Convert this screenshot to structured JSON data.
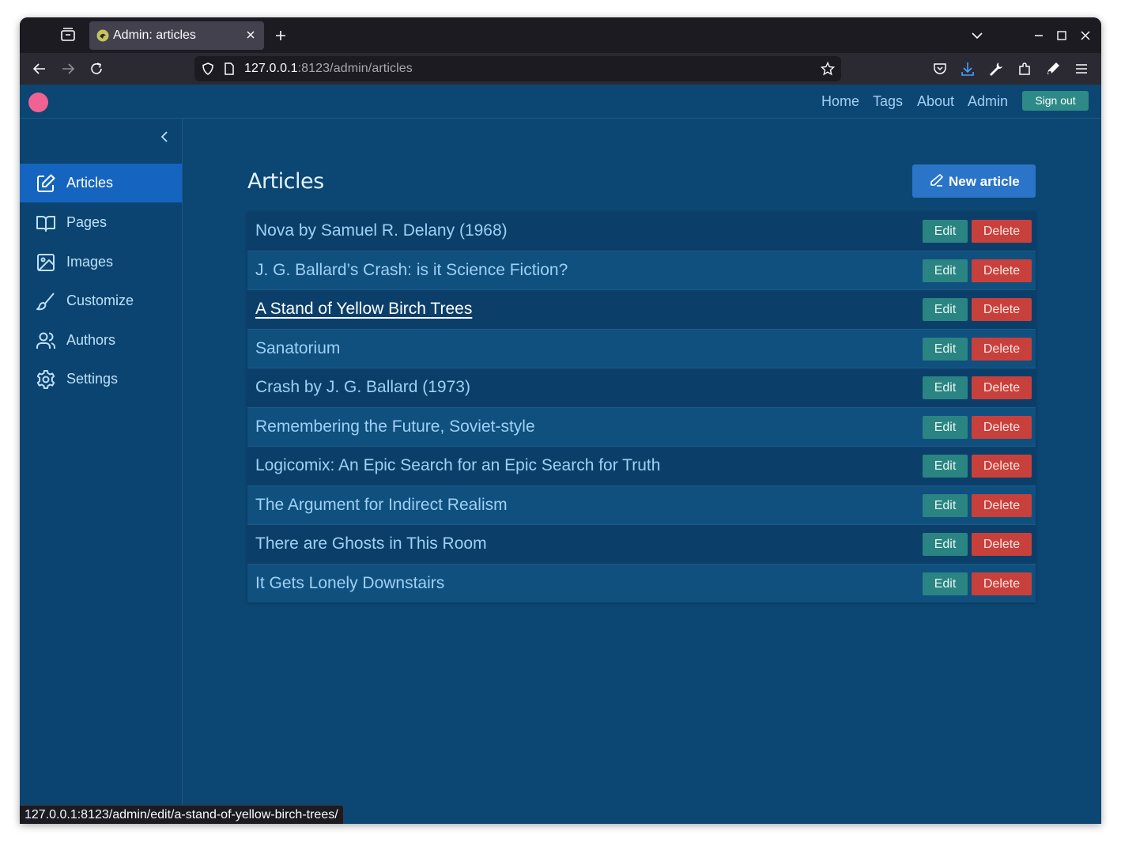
{
  "browser": {
    "tab_title": "Admin: articles",
    "url_host": "127.0.0.1",
    "url_rest": ":8123/admin/articles",
    "status_url": "127.0.0.1:8123/admin/edit/a-stand-of-yellow-birch-trees/"
  },
  "header": {
    "nav": [
      "Home",
      "Tags",
      "About",
      "Admin"
    ],
    "signout_label": "Sign out"
  },
  "sidebar": {
    "items": [
      {
        "label": "Articles",
        "icon": "edit-icon",
        "active": true
      },
      {
        "label": "Pages",
        "icon": "book-icon"
      },
      {
        "label": "Images",
        "icon": "image-icon"
      },
      {
        "label": "Customize",
        "icon": "brush-icon"
      },
      {
        "label": "Authors",
        "icon": "users-icon"
      },
      {
        "label": "Settings",
        "icon": "gear-icon"
      }
    ]
  },
  "main": {
    "title": "Articles",
    "new_article_label": "New article",
    "edit_label": "Edit",
    "delete_label": "Delete",
    "articles": [
      "Nova by Samuel R. Delany (1968)",
      "J. G. Ballard’s Crash: is it Science Fiction?",
      "A Stand of Yellow Birch Trees",
      "Sanatorium",
      "Crash by J. G. Ballard (1973)",
      "Remembering the Future, Soviet-style",
      "Logicomix: An Epic Search for an Epic Search for Truth",
      "The Argument for Indirect Realism",
      "There are Ghosts in This Room",
      "It Gets Lonely Downstairs"
    ]
  },
  "colors": {
    "page_bg": "#0c4672",
    "active_sidebar": "#1565c0",
    "edit_button": "#2a8482",
    "delete_button": "#c8403b",
    "new_article_button": "#2a75c8",
    "logo": "#f06292"
  }
}
